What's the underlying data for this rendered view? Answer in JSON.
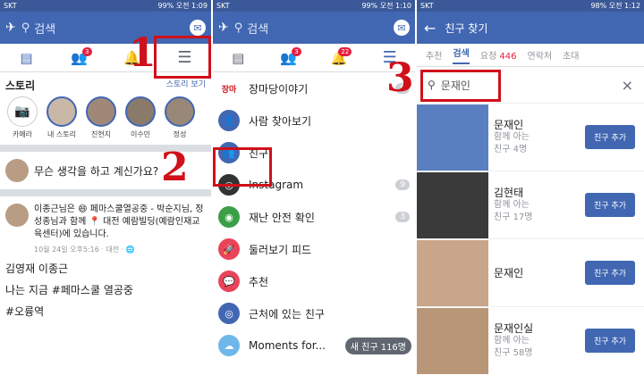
{
  "p1": {
    "status_left": "SKT",
    "status_right": "99% 오전 1:09",
    "search": "검색",
    "messenger": "✉",
    "tabs_badge_friends": "3",
    "stories_title": "스토리",
    "story_add_label": "스토리 보기",
    "stories": [
      "카메라",
      "내 스토리",
      "진현지",
      "이수민",
      "정성"
    ],
    "composer": "무슨 생각을 하고 계신가요?",
    "post_author": "이종근님은 😄 페마스쿨열공중 - 박순지님, 정성종님과 함께 📍 대전 예람빌딩(예람인재교육센터)에 있습니다.",
    "post_time": "10월 24일 오후5:16 · 대전 · 🌐",
    "post_lines": [
      "김영재 이종근",
      "나는 지금 #페마스쿨 열공중",
      "#오륭역"
    ]
  },
  "p2": {
    "status_left": "SKT",
    "status_right": "99% 오전 1:10",
    "search": "검색",
    "badge_friends": "3",
    "badge_notif": "22",
    "menu": [
      {
        "label": "장마당이야기",
        "count": "6",
        "color": "#fff",
        "icon": "장마"
      },
      {
        "label": "사람 찾아보기",
        "count": "",
        "color": "#4267b2",
        "icon": "👤"
      },
      {
        "label": "친구",
        "count": "",
        "color": "#4267b2",
        "icon": "👥"
      },
      {
        "label": "Instagram",
        "count": "9",
        "color": "#333",
        "icon": "◎"
      },
      {
        "label": "재난 안전 확인",
        "count": "3",
        "color": "#3b9f48",
        "icon": "◉"
      },
      {
        "label": "둘러보기 피드",
        "count": "",
        "color": "#e9445a",
        "icon": "🚀"
      },
      {
        "label": "추천",
        "count": "",
        "color": "#e9445a",
        "icon": "💬"
      },
      {
        "label": "근처에 있는 친구",
        "count": "",
        "color": "#4267b2",
        "icon": "◎"
      },
      {
        "label": "Moments for...",
        "count": "",
        "color": "#6fb7ea",
        "icon": "☁"
      }
    ],
    "new_friends": "새 친구 116명"
  },
  "p3": {
    "status_left": "SKT",
    "status_right": "98% 오전 1:12",
    "title": "친구 찾기",
    "back": "←",
    "tabs": [
      "추천",
      "검색",
      "요청",
      "446",
      "연락처",
      "초대"
    ],
    "search_value": "문재인",
    "close": "×",
    "results": [
      {
        "name": "문재인",
        "sub1": "함께 아는",
        "sub2": "친구 4명",
        "btn": "친구 추가"
      },
      {
        "name": "김현태",
        "sub1": "함께 아는",
        "sub2": "친구 17명",
        "btn": "친구 추가"
      },
      {
        "name": "문재인",
        "sub1": "",
        "sub2": "",
        "btn": "친구 추가"
      },
      {
        "name": "문재인실",
        "sub1": "함께 아는",
        "sub2": "친구 58명",
        "btn": "친구 추가"
      }
    ]
  },
  "annotations": [
    "1",
    "2",
    "3"
  ]
}
